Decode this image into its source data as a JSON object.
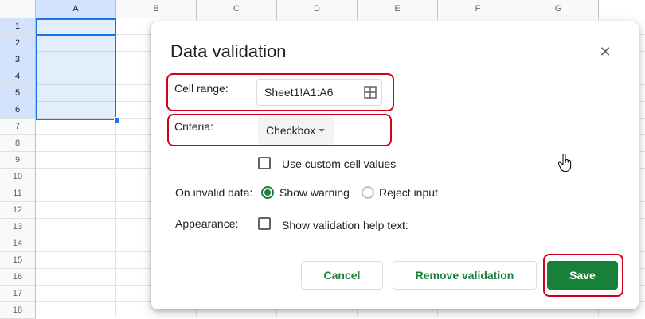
{
  "sheet": {
    "columns": [
      "A",
      "B",
      "C",
      "D",
      "E",
      "F",
      "G"
    ],
    "rows": [
      "1",
      "2",
      "3",
      "4",
      "5",
      "6",
      "7",
      "8",
      "9",
      "10",
      "11",
      "12",
      "13",
      "14",
      "15",
      "16",
      "17",
      "18"
    ]
  },
  "dialog": {
    "title": "Data validation",
    "cell_range_label": "Cell range:",
    "cell_range_value": "Sheet1!A1:A6",
    "criteria_label": "Criteria:",
    "criteria_value": "Checkbox",
    "custom_values_label": "Use custom cell values",
    "invalid_label": "On invalid data:",
    "show_warning_label": "Show warning",
    "reject_input_label": "Reject input",
    "invalid_selected": "Show warning",
    "appearance_label": "Appearance:",
    "help_text_label": "Show validation help text:",
    "cancel_label": "Cancel",
    "remove_label": "Remove validation",
    "save_label": "Save"
  },
  "icons": {
    "close": "close-icon",
    "range": "grid-select-icon",
    "dropdown": "caret-down-icon",
    "cursor": "hand-pointer-icon"
  },
  "colors": {
    "accent": "#188038",
    "selection": "#1a73e8",
    "annotation": "#d0021b"
  }
}
